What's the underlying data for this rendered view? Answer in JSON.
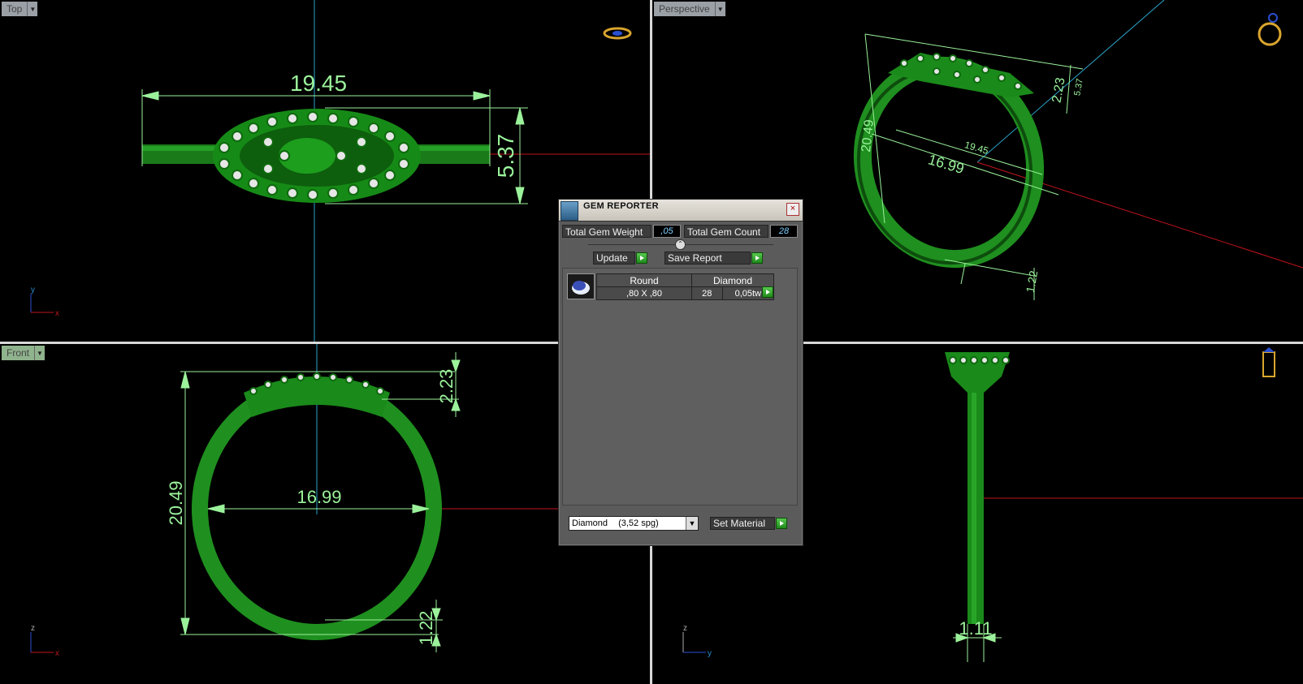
{
  "viewports": {
    "top": {
      "label": "Top",
      "dim_width": "19.45",
      "dim_height": "5.37",
      "axis_v": "y",
      "axis_h": "x"
    },
    "perspective": {
      "label": "Perspective",
      "dim_a": "20.49",
      "dim_b": "19.45",
      "dim_c": "16.99",
      "dim_d": "2.23",
      "dim_e": "1.22",
      "dim_f": "5.37"
    },
    "front": {
      "label": "Front",
      "dim_outer": "20.49",
      "dim_inner": "16.99",
      "dim_top": "2.23",
      "dim_bottom": "1.22",
      "axis_v": "z",
      "axis_h": "x"
    },
    "side": {
      "dim_width": "1.11",
      "axis_v": "z",
      "axis_h": "y"
    }
  },
  "gem_reporter": {
    "title": "GEM REPORTER",
    "close_glyph": "×",
    "total_weight_label": "Total Gem Weight",
    "total_weight_value": ",05",
    "total_count_label": "Total Gem Count",
    "total_count_value": "28",
    "update_label": "Update",
    "save_label": "Save Report",
    "table": {
      "headers": [
        "Round",
        "Diamond"
      ],
      "row": {
        "size": ",80 X ,80",
        "count": "28",
        "weight": "0,05tw"
      }
    },
    "material_select": {
      "name": "Diamond",
      "sg": "(3,52 spg)"
    },
    "set_material_label": "Set Material"
  },
  "colors": {
    "ring": "#1f9b1f",
    "dim": "#9bf29b",
    "axis_red": "#c0141b",
    "axis_blue": "#2aa3c9",
    "panel": "#5b5b5b"
  }
}
